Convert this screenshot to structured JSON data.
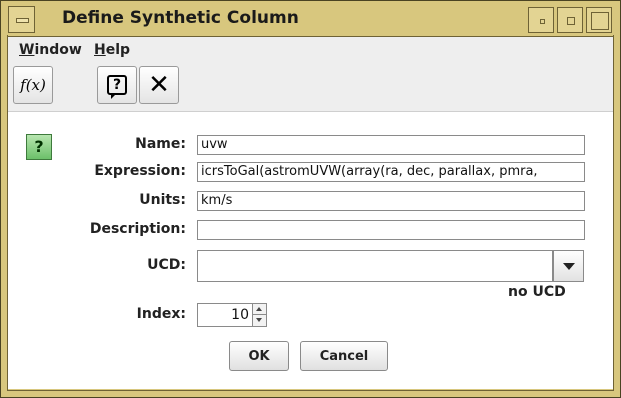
{
  "window": {
    "title": "Define Synthetic Column"
  },
  "menu": {
    "window": {
      "mnemonic": "W",
      "rest": "indow"
    },
    "help": {
      "mnemonic": "H",
      "rest": "elp"
    }
  },
  "toolbar": {
    "function_label": "f(x)",
    "help_icon": "help-question-icon",
    "close_icon": "x-close-icon"
  },
  "form": {
    "help_glyph": "?",
    "name": {
      "label": "Name:",
      "value": "uvw"
    },
    "expression": {
      "label": "Expression:",
      "value": "icrsToGal(astromUVW(array(ra, dec, parallax, pmra,"
    },
    "units": {
      "label": "Units:",
      "value": "km/s"
    },
    "description": {
      "label": "Description:",
      "value": ""
    },
    "ucd": {
      "label": "UCD:",
      "value": "",
      "status": "no UCD"
    },
    "index": {
      "label": "Index:",
      "value": "10"
    }
  },
  "buttons": {
    "ok": "OK",
    "cancel": "Cancel"
  }
}
